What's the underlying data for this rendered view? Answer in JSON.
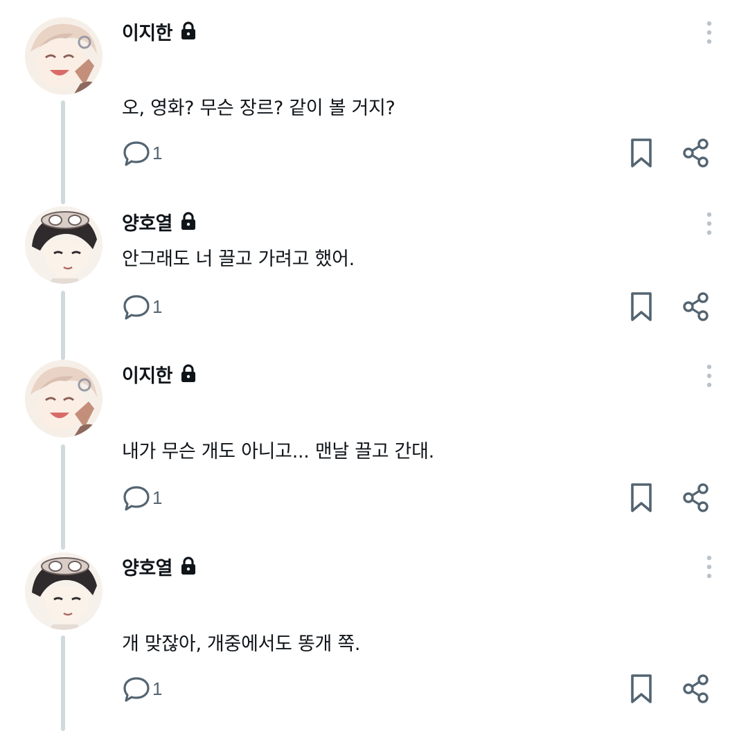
{
  "posts": [
    {
      "avatar": "avatar-lee-jihan",
      "name": "이지한",
      "text": "오, 영화? 무슨 장르? 같이 볼 거지?",
      "reply_count": "1"
    },
    {
      "avatar": "avatar-yang-hoyeol",
      "name": "양호열",
      "text": "안그래도 너 끌고 가려고 했어.",
      "reply_count": "1"
    },
    {
      "avatar": "avatar-lee-jihan",
      "name": "이지한",
      "text": "내가 무슨 개도 아니고... 맨날 끌고 간대.",
      "reply_count": "1"
    },
    {
      "avatar": "avatar-yang-hoyeol",
      "name": "양호열",
      "text": "개 맞잖아, 개중에서도 똥개 쪽.",
      "reply_count": "1"
    }
  ],
  "icons": {
    "lock": "lock-icon",
    "more": "more-vertical-icon",
    "reply": "reply-bubble-icon",
    "bookmark": "bookmark-icon",
    "share": "share-icon"
  },
  "colors": {
    "text": "#0f1419",
    "muted": "#536471",
    "icon": "#536471",
    "thread_line": "#cfd9de",
    "more_dots": "#b9c3cb"
  }
}
